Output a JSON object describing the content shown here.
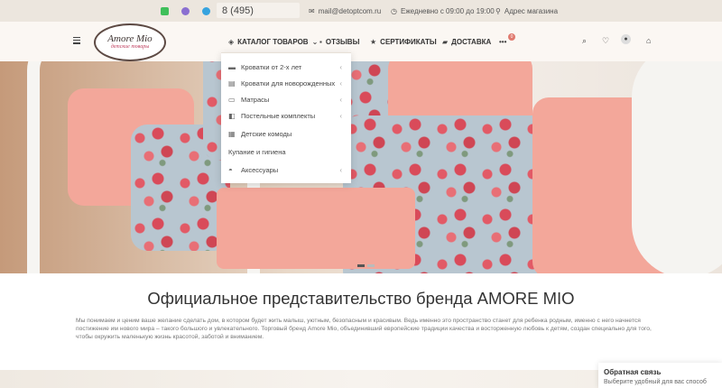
{
  "topbar": {
    "phone": "8 (495)",
    "email": "mail@detoptcom.ru",
    "hours": "Ежедневно с 09:00 до 19:00",
    "address": "Адрес магазина",
    "messenger_colors": [
      "#3fbf5a",
      "#8a6fd1",
      "#36a3df"
    ]
  },
  "header": {
    "logo_text": "Amore Mio",
    "logo_sub": "детские товары",
    "nav": {
      "catalog": "КАТАЛОГ ТОВАРОВ",
      "reviews": "ОТЗЫВЫ",
      "certificates": "СЕРТИФИКАТЫ",
      "delivery": "ДОСТАВКА",
      "more_badge": "0"
    }
  },
  "catalog_menu": [
    {
      "label": "Кроватки от 2-х лет",
      "icon": "bed-icon",
      "has_sub": true
    },
    {
      "label": "Кроватки для новорожденных",
      "icon": "crib-icon",
      "has_sub": true
    },
    {
      "label": "Матрасы",
      "icon": "mattress-icon",
      "has_sub": true
    },
    {
      "label": "Постельные комплекты",
      "icon": "bedding-icon",
      "has_sub": true
    },
    {
      "label": "Детские комоды",
      "icon": "dresser-icon",
      "has_sub": false
    },
    {
      "label": "Купание и гигиена",
      "icon": "",
      "has_sub": false
    },
    {
      "label": "Аксессуары",
      "icon": "pram-icon",
      "has_sub": true
    }
  ],
  "content": {
    "headline": "Официальное представительство бренда AMORE MIO",
    "paragraph": "Мы понимаем и ценим ваше желание сделать дом, в котором будет жить малыш, уютным, безопасным и красивым. Ведь именно это пространство станет для ребенка родным, именно с него начнется постижение им нового мира – такого большого и увлекательного. Торговый бренд Amore Mio, объединивший европейские традиции качества и восторженную любовь к детям, создан специально для того, чтобы окружить маленькую жизнь красотой, заботой и вниманием."
  },
  "feedback": {
    "title": "Обратная связь",
    "subtitle": "Выберите удобный для вас способ"
  }
}
